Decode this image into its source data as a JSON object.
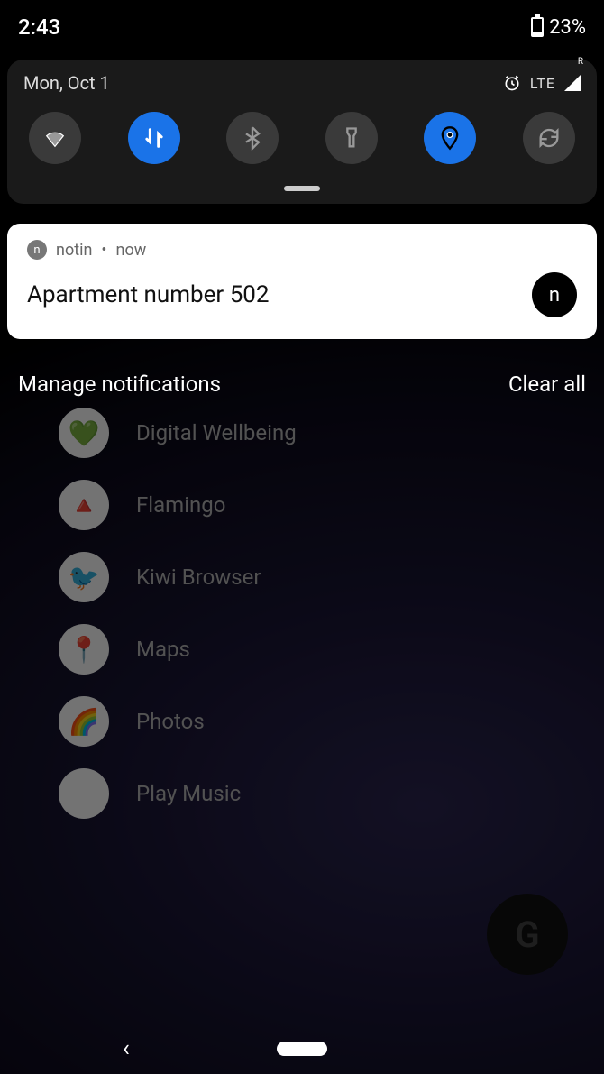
{
  "status": {
    "time": "2:43",
    "battery_pct": "23%"
  },
  "shade": {
    "date": "Mon, Oct 1",
    "network": "LTE",
    "toggles": {
      "wifi": false,
      "data": true,
      "bluetooth": false,
      "flashlight": false,
      "location": true,
      "rotate": false
    }
  },
  "notification": {
    "app": "notin",
    "time": "now",
    "dot": "•",
    "title": "Apartment number 502",
    "icon_letter": "n"
  },
  "actions": {
    "manage": "Manage notifications",
    "clear": "Clear all"
  },
  "bg_apps": [
    {
      "label": "Digital Wellbeing",
      "emoji": "💚"
    },
    {
      "label": "Flamingo",
      "emoji": "🔺"
    },
    {
      "label": "Kiwi Browser",
      "emoji": "🐦"
    },
    {
      "label": "Maps",
      "emoji": "📍"
    },
    {
      "label": "Photos",
      "emoji": "🌈"
    },
    {
      "label": "Play Music",
      "emoji": "▶"
    }
  ],
  "fab": "G"
}
